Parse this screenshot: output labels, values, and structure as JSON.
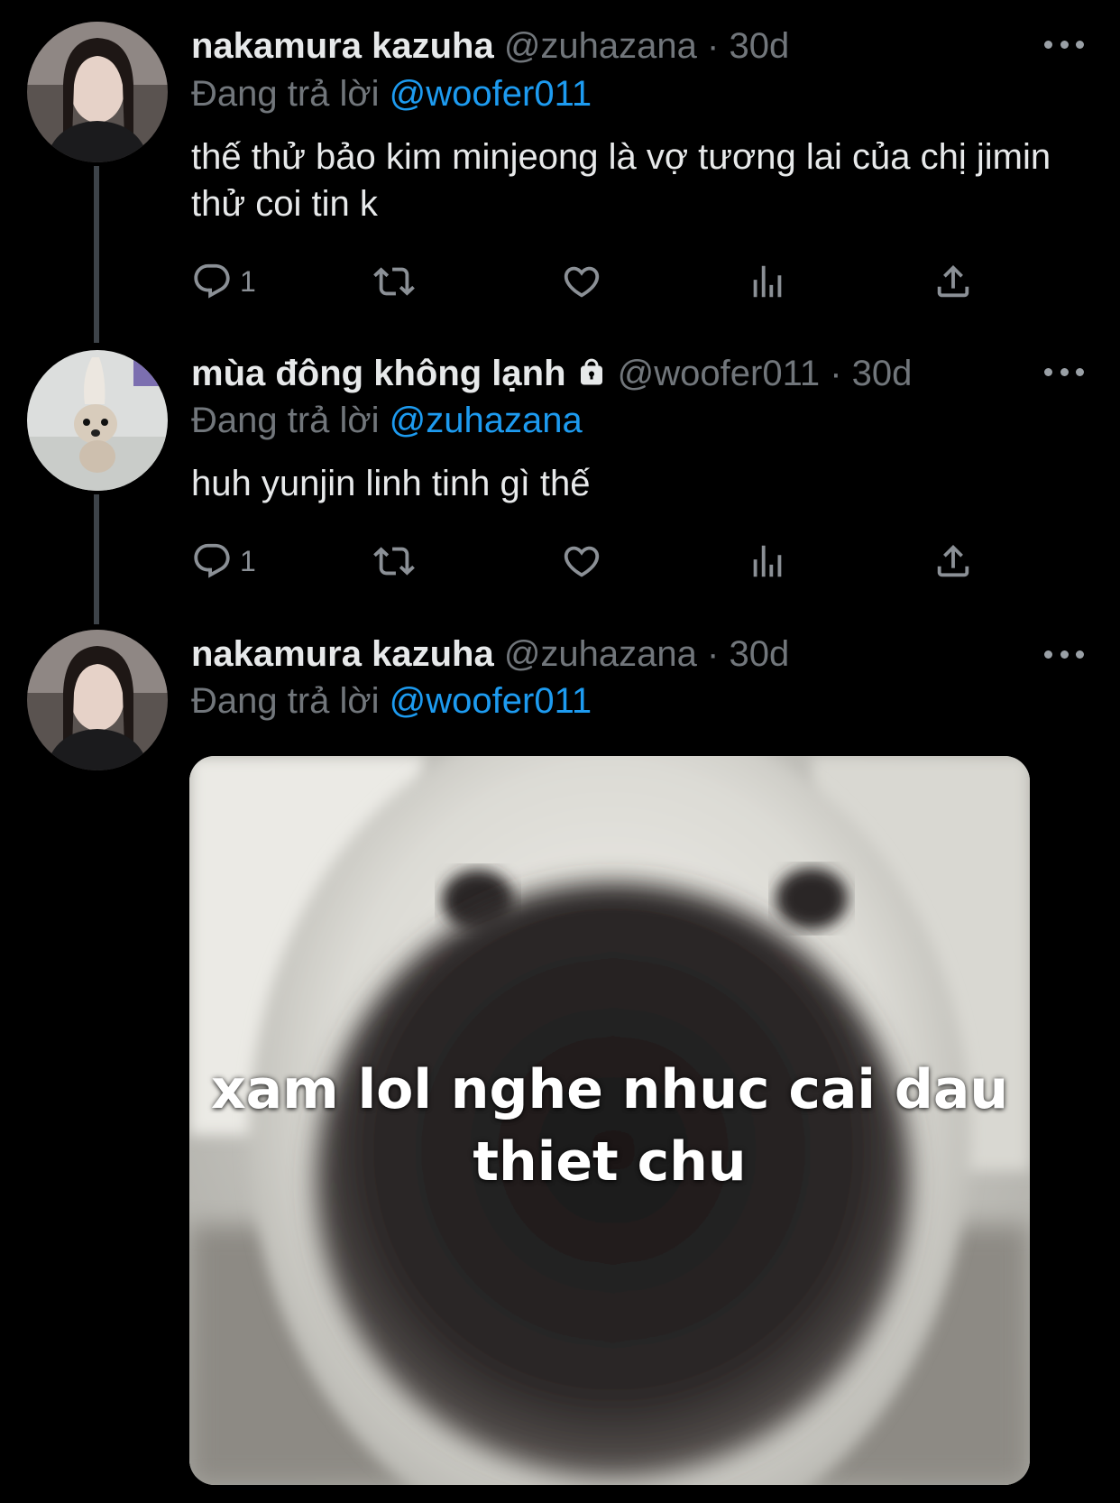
{
  "tweets": [
    {
      "name": "nakamura kazuha",
      "handle": "@zuhazana",
      "dot": "·",
      "time": "30d",
      "replying_prefix": "Đang trả lời",
      "replying_to": "@woofer011",
      "text": "thế thử bảo kim minjeong là vợ tương lai của chị jimin thử coi tin k",
      "reply_count": "1"
    },
    {
      "name": "mùa đông không lạnh",
      "protected": true,
      "handle": "@woofer011",
      "dot": "·",
      "time": "30d",
      "replying_prefix": "Đang trả lời",
      "replying_to": "@zuhazana",
      "text": "huh yunjin linh tinh gì thế",
      "reply_count": "1"
    },
    {
      "name": "nakamura kazuha",
      "handle": "@zuhazana",
      "dot": "·",
      "time": "30d",
      "replying_prefix": "Đang trả lời",
      "replying_to": "@woofer011",
      "media_caption_line1": "xam lol nghe nhuc cai dau",
      "media_caption_line2": "thiet chu"
    }
  ],
  "icons": [
    "reply-icon",
    "retweet-icon",
    "like-icon",
    "views-icon",
    "share-icon",
    "more-icon",
    "lock-icon"
  ],
  "colors": {
    "background": "#000000",
    "text": "#e7e9ea",
    "muted": "#71767b",
    "mention": "#1d9bf0"
  }
}
